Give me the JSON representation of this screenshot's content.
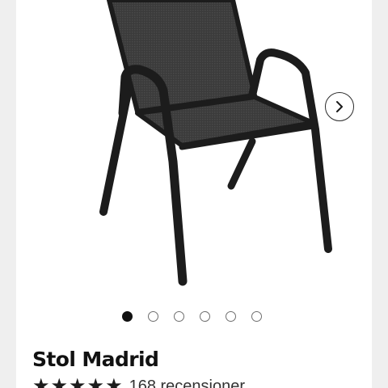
{
  "product": {
    "title": "Stol Madrid",
    "image_alt": "Stol Madrid",
    "rating": 5,
    "review_count_text": "168 recensioner"
  },
  "gallery": {
    "total_images": 6,
    "active_index": 0
  },
  "icons": {
    "next": "chevron-right-icon",
    "star": "star-icon"
  },
  "colors": {
    "frame": "#1c1c1c",
    "mesh": "#3a3a3a",
    "active_dot": "#111111"
  }
}
